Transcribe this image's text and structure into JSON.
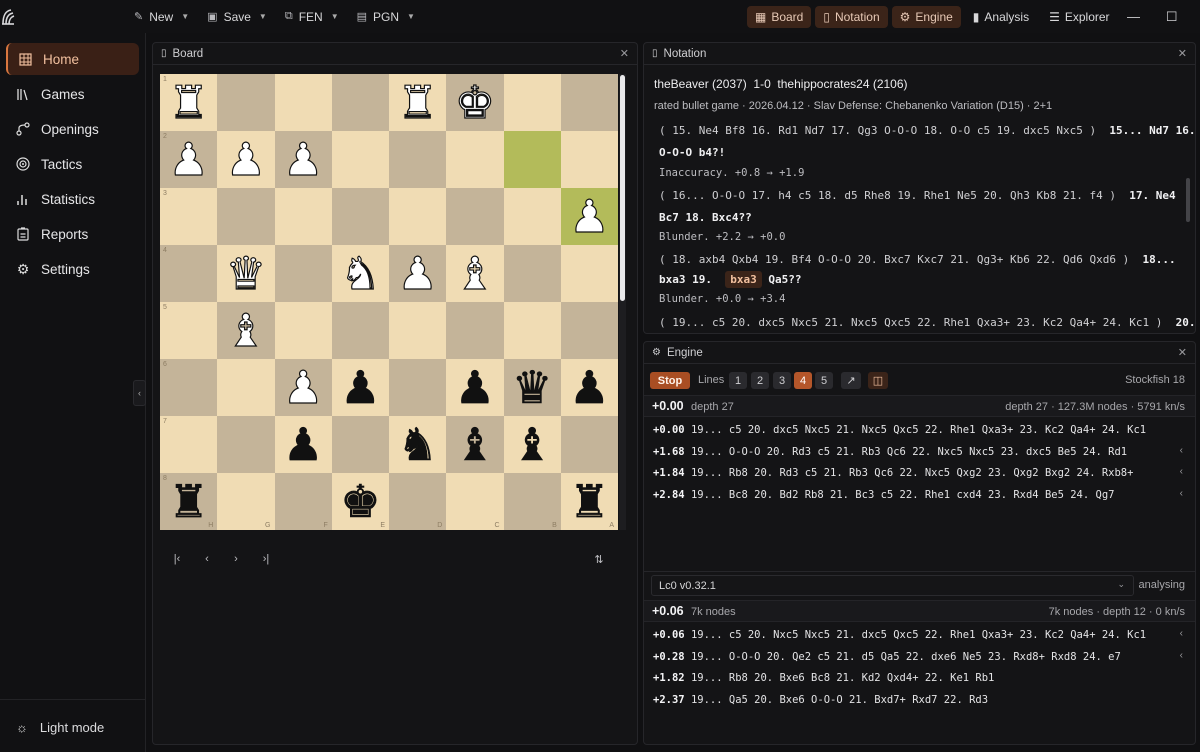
{
  "titlebar": {
    "menus": [
      {
        "label": "New",
        "icon": "new-file-icon"
      },
      {
        "label": "Save",
        "icon": "save-icon"
      },
      {
        "label": "FEN",
        "icon": "copy-icon"
      },
      {
        "label": "PGN",
        "icon": "document-icon"
      }
    ],
    "toggles": [
      {
        "label": "Board",
        "icon": "board-icon",
        "active": true
      },
      {
        "label": "Notation",
        "icon": "book-icon",
        "active": true
      },
      {
        "label": "Engine",
        "icon": "engine-icon",
        "active": true
      },
      {
        "label": "Analysis",
        "icon": "bar-chart-icon",
        "active": false
      },
      {
        "label": "Explorer",
        "icon": "database-icon",
        "active": false
      }
    ]
  },
  "sidebar": {
    "items": [
      {
        "label": "Home",
        "icon": "home-grid-icon",
        "active": true
      },
      {
        "label": "Games",
        "icon": "library-icon"
      },
      {
        "label": "Openings",
        "icon": "openings-icon"
      },
      {
        "label": "Tactics",
        "icon": "target-icon"
      },
      {
        "label": "Statistics",
        "icon": "stats-icon"
      },
      {
        "label": "Reports",
        "icon": "clipboard-icon"
      },
      {
        "label": "Settings",
        "icon": "gear-icon"
      }
    ],
    "theme_toggle": "Light mode"
  },
  "board_panel": {
    "title": "Board",
    "ranks": [
      "1",
      "2",
      "3",
      "4",
      "5",
      "6",
      "7",
      "8"
    ],
    "files": [
      "H",
      "G",
      "F",
      "E",
      "D",
      "C",
      "B",
      "A"
    ],
    "position": [
      [
        "wR",
        "",
        "",
        "",
        "wR",
        "wK",
        "",
        ""
      ],
      [
        "wP",
        "wP",
        "wP",
        "",
        "",
        "",
        "",
        ""
      ],
      [
        "",
        "",
        "",
        "",
        "",
        "",
        "",
        "wP"
      ],
      [
        "",
        "wQ",
        "",
        "wN",
        "wP",
        "wB",
        "",
        ""
      ],
      [
        "",
        "wB",
        "",
        "",
        "",
        "",
        "",
        ""
      ],
      [
        "",
        "",
        "wP",
        "bP",
        "",
        "bP",
        "bQ",
        "bP"
      ],
      [
        "",
        "",
        "bP",
        "",
        "bN",
        "bB",
        "bB",
        ""
      ],
      [
        "bR",
        "",
        "",
        "bK",
        "",
        "",
        "",
        "bR"
      ]
    ],
    "highlight": [
      [
        1,
        6
      ],
      [
        2,
        7
      ]
    ],
    "nav": [
      "first-move-icon",
      "prev-move-icon",
      "next-move-icon",
      "last-move-icon"
    ]
  },
  "notation_panel": {
    "title": "Notation",
    "white": "theBeaver (2037)",
    "result": "1-0",
    "black": "thehippocrates24 (2106)",
    "meta": "rated bullet game · 2026.04.12 · Slav Defense: Chebanenko Variation (D15) · 2+1",
    "lines": [
      {
        "var": "( 15.  Ne4  Bf8  16.  Rd1  Nd7  17.  Qg3  O-O-O  18.  O-O  c5  19.  dxc5  Nxc5  )",
        "main": "15...  Nd7  16."
      },
      {
        "main": "O-O-O  b4?!"
      },
      {
        "comment": "Inaccuracy. +0.8 → +1.9"
      },
      {
        "var": "( 16...  O-O-O  17.  h4  c5  18.  d5  Rhe8  19.  Rhe1  Ne5  20.  Qh3  Kb8  21.  f4  )",
        "main": "17.  Ne4"
      },
      {
        "main": "Bc7  18.  Bxc4??"
      },
      {
        "comment": "Blunder. +2.2 → +0.0"
      },
      {
        "var": "( 18.  axb4  Qxb4  19.  Bf4  O-O-O  20.  Bxc7  Kxc7  21.  Qg3+  Kb6  22.  Qd6  Qxd6  )",
        "main": "18..."
      },
      {
        "main_pre": "bxa3  19.",
        "current": "bxa3",
        "main_post": "Qa5??"
      },
      {
        "comment": "Blunder. +0.0 → +3.4"
      },
      {
        "var": "( 19...  c5  20.  dxc5  Nxc5  21.  Nxc5  Qxc5  22.  Rhe1  Qxa3+  23.  Kc2  Qa4+  24.  Kc1  )",
        "main": "20."
      }
    ]
  },
  "engine_panel": {
    "title": "Engine",
    "stop_label": "Stop",
    "lines_label": "Lines",
    "line_counts": [
      "1",
      "2",
      "3",
      "4",
      "5"
    ],
    "selected_lines": "4",
    "engine1": {
      "name": "Stockfish 18",
      "score": "+0.00",
      "depth": "depth 27",
      "stats": "depth 27 · 127.3M nodes · 5791 kn/s",
      "pvs": [
        {
          "score": "+0.00",
          "moves": "19...  c5  20.  dxc5  Nxc5  21.  Nxc5  Qxc5  22.  Rhe1  Qxa3+  23.  Kc2  Qa4+  24.  Kc1"
        },
        {
          "score": "+1.68",
          "moves": "19...  O-O-O  20.  Rd3  c5  21.  Rb3  Qc6  22.  Nxc5  Nxc5  23.  dxc5  Be5  24.  Rd1"
        },
        {
          "score": "+1.84",
          "moves": "19...  Rb8  20.  Rd3  c5  21.  Rb3  Qc6  22.  Nxc5  Qxg2  23.  Qxg2  Bxg2  24.  Rxb8+"
        },
        {
          "score": "+2.84",
          "moves": "19...  Bc8  20.  Bd2  Rb8  21.  Bc3  c5  22.  Rhe1  cxd4  23.  Rxd4  Be5  24.  Qg7"
        }
      ]
    },
    "engine2": {
      "name": "Lc0 v0.32.1",
      "status": "analysing",
      "score": "+0.06",
      "nodes": "7k nodes",
      "stats": "7k nodes · depth 12 · 0 kn/s",
      "pvs": [
        {
          "score": "+0.06",
          "moves": "19...  c5  20.  Nxc5  Nxc5  21.  dxc5  Qxc5  22.  Rhe1  Qxa3+  23.  Kc2  Qa4+  24.  Kc1"
        },
        {
          "score": "+0.28",
          "moves": "19...  O-O-O  20.  Qe2  c5  21.  d5  Qa5  22.  dxe6  Ne5  23.  Rxd8+  Rxd8  24.  e7"
        },
        {
          "score": "+1.82",
          "moves": "19...  Rb8  20.  Bxe6  Bc8  21.  Kd2  Qxd4+  22.  Ke1  Rb1"
        },
        {
          "score": "+2.37",
          "moves": "19...  Qa5  20.  Bxe6  O-O-O  21.  Bxd7+  Rxd7  22.  Rd3"
        }
      ]
    }
  }
}
